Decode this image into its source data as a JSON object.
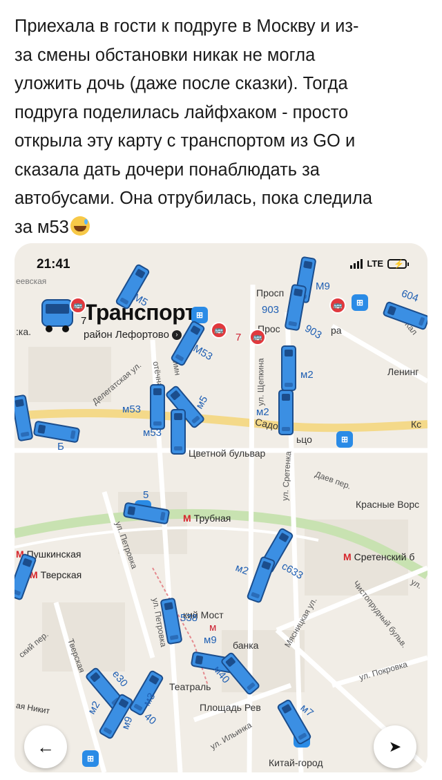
{
  "post": {
    "lines": [
      "Приехала в гости к подруге в Москву и из-",
      "за смены обстановки никак не могла",
      "уложить дочь (даже после сказки). Тогда",
      "подруга поделилась лайфхаком - просто",
      "открыла эту карту с транспортом из GO и",
      "сказала дать дочери понаблюдать за",
      "автобусами. Она отрубилась, пока следила",
      "за м53"
    ]
  },
  "status_bar": {
    "time": "21:41",
    "network": "LTE"
  },
  "app": {
    "title": "Транспорт",
    "subtitle": "район Лефортово"
  },
  "map": {
    "places": {
      "tl": "еевская",
      "ka": ":ка.",
      "prosp1": "Просп",
      "prosp2": "Прос",
      "lenin": "Ленинг",
      "ka2": "Кс",
      "sadovoe": "Садовое",
      "tso": "ьцо",
      "tsvetnoy": "Цветной бульвар",
      "krasnye": "Красные Ворс",
      "teatral": "Театраль",
      "plosh": "Площадь Рев",
      "kitay": "Китай-город",
      "nikit": "ая Никит",
      "mostkiy": "кий Мост",
      "banka": "банка",
      "ra": "ра"
    },
    "metro": {
      "trubnaya": "Трубная",
      "pushkinskaya": "Пушкинская",
      "tverskaya": "Тверская",
      "sretensky": "Сретенский б",
      "metro_letter": "М"
    },
    "streets": {
      "delegatskaya": "Делегатская ул.",
      "samotechnaya": "отёчная",
      "shepkina": "ул. Щепкина",
      "sretenka": "ул. Сретенка",
      "daev": "Даев пер.",
      "petrovka1": "ул. Петровка",
      "petrovka2": "ул. Петровка",
      "tverskaya": "Тверская",
      "myasnitskaya": "Мясницкая ул.",
      "chistoprudny": "Чистопрудный бульв.",
      "pokrovka": "ул. Покровка",
      "ilyinka": "ул. Ильинка",
      "kal": "Кал",
      "skiy": "ский пер.",
      "ul": "ул.",
      "limn": "лимн"
    },
    "routes": {
      "r1": "M5",
      "r2": "M9",
      "r3": "604",
      "r4": "903",
      "r5": "903",
      "r6": "M53",
      "r7": "м2",
      "r8": "м53",
      "r9": "м5",
      "r10": "м2",
      "r11": "м53",
      "r12": "Б",
      "r13": "м2",
      "r14": "с633",
      "r15": "538",
      "r16": "м9",
      "r17": "м40",
      "r18": "е30",
      "r19": "м2",
      "r20": "м9",
      "r21": "м3",
      "r22": "40",
      "r23": "м7",
      "r24": "5",
      "r25": "7",
      "r26": "7",
      "r27": "м"
    }
  },
  "colors": {
    "bus": "#3b8fe3",
    "bus_border": "#1b4d8c",
    "metro": "#d6252b",
    "map_bg": "#f1ede6"
  }
}
